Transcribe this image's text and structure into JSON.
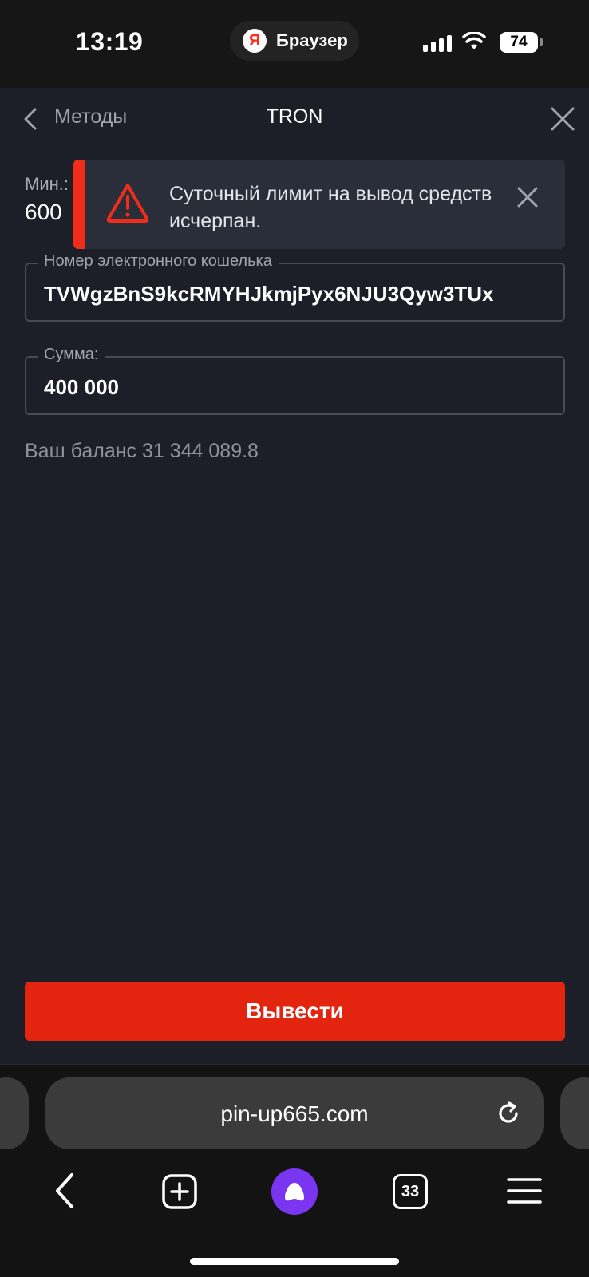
{
  "status_bar": {
    "time": "13:19",
    "browser_label": "Браузер",
    "browser_logo_letter": "Я",
    "battery": "74"
  },
  "nav": {
    "back_label": "Методы",
    "title": "TRON"
  },
  "limits": {
    "min_label": "Мин.:",
    "min_value": "600"
  },
  "toast": {
    "message": "Суточный лимит на вывод средств исчерпан.",
    "icon": "warning-triangle-icon",
    "accent_color": "#f02d1a"
  },
  "form": {
    "wallet_label": "Номер электронного кошелька",
    "wallet_value": "TVWgzBnS9kcRMYHJkmjPyx6NJU3Qyw3TUx",
    "amount_label": "Сумма:",
    "amount_value": "400 000",
    "balance_text": "Ваш баланс 31 344 089.8",
    "submit_label": "Вывести",
    "submit_color": "#e3250f"
  },
  "browser": {
    "url": "pin-up665.com",
    "tabs_count": "33",
    "assistant_color": "#7a35f0"
  }
}
